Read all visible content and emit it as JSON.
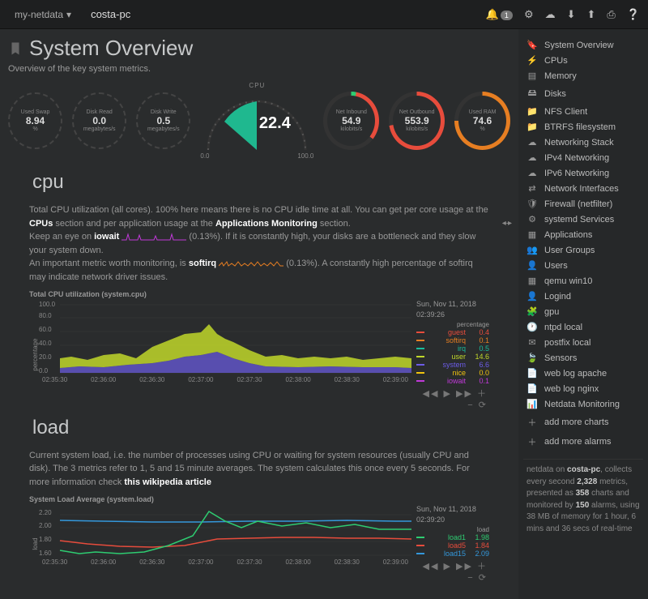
{
  "topbar": {
    "brand": "my-netdata",
    "hostname": "costa-pc",
    "alarm_count": "1"
  },
  "header": {
    "title": "System Overview",
    "subtitle": "Overview of the key system metrics."
  },
  "gauges": {
    "swap": {
      "label": "Used Swap",
      "value": "8.94",
      "unit": "%"
    },
    "diskRead": {
      "label": "Disk Read",
      "value": "0.0",
      "unit": "megabytes/s"
    },
    "diskWrite": {
      "label": "Disk Write",
      "value": "0.5",
      "unit": "megabytes/s"
    },
    "cpu": {
      "label": "CPU",
      "value": "22.4",
      "min": "0.0",
      "max": "100.0"
    },
    "netIn": {
      "label": "Net Inbound",
      "value": "54.9",
      "unit": "kilobits/s"
    },
    "netOut": {
      "label": "Net Outbound",
      "value": "553.9",
      "unit": "kilobits/s"
    },
    "ram": {
      "label": "Used RAM",
      "value": "74.6",
      "unit": "%"
    }
  },
  "cpu": {
    "heading": "cpu",
    "p1a": "Total CPU utilization (all cores). 100% here means there is no CPU idle time at all. You can get per core usage at the ",
    "p1b": "CPUs",
    "p1c": " section and per application usage at the ",
    "p1d": "Applications Monitoring",
    "p1e": " section.",
    "p2a": "Keep an eye on ",
    "p2b": "iowait",
    "p2c": " (",
    "p2d": "0.13%",
    "p2e": "). If it is constantly high, your disks are a bottleneck and they slow your system down.",
    "p3a": "An important metric worth monitoring, is ",
    "p3b": "softirq",
    "p3c": " (",
    "p3d": "0.13%",
    "p3e": "). A constantly high percentage of softirq may indicate network driver issues."
  },
  "cpu_chart": {
    "title": "Total CPU utilization (system.cpu)",
    "ylabel": "percentage",
    "ts1": "Sun, Nov 11, 2018",
    "ts2": "02:39:26",
    "lhead": "percentage",
    "legend": [
      {
        "name": "guest",
        "value": "0.4",
        "color": "#e74c3c"
      },
      {
        "name": "softirq",
        "value": "0.1",
        "color": "#e67e22"
      },
      {
        "name": "irq",
        "value": "0.5",
        "color": "#1abc9c"
      },
      {
        "name": "user",
        "value": "14.6",
        "color": "#c0d72a"
      },
      {
        "name": "system",
        "value": "6.6",
        "color": "#6c5ce7"
      },
      {
        "name": "nice",
        "value": "0.0",
        "color": "#f1c40f"
      },
      {
        "name": "iowait",
        "value": "0.1",
        "color": "#c039d8"
      }
    ],
    "xticks": [
      "02:35:30",
      "02:36:00",
      "02:36:30",
      "02:37:00",
      "02:37:30",
      "02:38:00",
      "02:38:30",
      "02:39:00"
    ],
    "yticks": [
      "0.0",
      "20.0",
      "40.0",
      "60.0",
      "80.0",
      "100.0"
    ],
    "controls": "◀◀ ▶ ▶▶ ＋ − ⟳"
  },
  "load": {
    "heading": "load",
    "p1": "Current system load, i.e. the number of processes using CPU or waiting for system resources (usually CPU and disk). The 3 metrics refer to 1, 5 and 15 minute averages. The system calculates this once every 5 seconds. For more information check ",
    "p1link": "this wikipedia article"
  },
  "load_chart": {
    "title": "System Load Average (system.load)",
    "ylabel": "load",
    "ts1": "Sun, Nov 11, 2018",
    "ts2": "02:39:20",
    "lhead": "load",
    "legend": [
      {
        "name": "load1",
        "value": "1.98",
        "color": "#2ecc71"
      },
      {
        "name": "load5",
        "value": "1.84",
        "color": "#e74c3c"
      },
      {
        "name": "load15",
        "value": "2.09",
        "color": "#3498db"
      }
    ],
    "yticks": [
      "1.60",
      "1.80",
      "2.00",
      "2.20"
    ],
    "xticks": [
      "02:35:30",
      "02:36:00",
      "02:36:30",
      "02:37:00",
      "02:37:30",
      "02:38:00",
      "02:38:30",
      "02:39:00"
    ],
    "controls": "◀◀ ▶ ▶▶ ＋ − ⟳"
  },
  "sidebar": {
    "items": [
      {
        "icon": "🔖",
        "label": "System Overview"
      },
      {
        "icon": "⚡",
        "label": "CPUs"
      },
      {
        "icon": "▤",
        "label": "Memory"
      },
      {
        "icon": "🖴",
        "label": "Disks"
      },
      {
        "icon": "📁",
        "label": "NFS Client"
      },
      {
        "icon": "📁",
        "label": "BTRFS filesystem"
      },
      {
        "icon": "☁",
        "label": "Networking Stack"
      },
      {
        "icon": "☁",
        "label": "IPv4 Networking"
      },
      {
        "icon": "☁",
        "label": "IPv6 Networking"
      },
      {
        "icon": "⇄",
        "label": "Network Interfaces"
      },
      {
        "icon": "🛡",
        "label": "Firewall (netfilter)"
      },
      {
        "icon": "⚙",
        "label": "systemd Services"
      },
      {
        "icon": "▦",
        "label": "Applications"
      },
      {
        "icon": "👥",
        "label": "User Groups"
      },
      {
        "icon": "👤",
        "label": "Users"
      },
      {
        "icon": "▦",
        "label": "qemu win10"
      },
      {
        "icon": "👤",
        "label": "Logind"
      },
      {
        "icon": "🧩",
        "label": "gpu"
      },
      {
        "icon": "🕐",
        "label": "ntpd local"
      },
      {
        "icon": "✉",
        "label": "postfix local"
      },
      {
        "icon": "🍃",
        "label": "Sensors"
      },
      {
        "icon": "📄",
        "label": "web log apache"
      },
      {
        "icon": "📄",
        "label": "web log nginx"
      },
      {
        "icon": "📊",
        "label": "Netdata Monitoring"
      }
    ],
    "add_charts": "add more charts",
    "add_alarms": "add more alarms",
    "info_host": "costa-pc",
    "info_metrics": "2,328",
    "info_charts": "358",
    "info_alarms": "150",
    "info_uptime": "1 hour, 6 mins and 36 secs"
  },
  "chart_data": [
    {
      "type": "area",
      "title": "Total CPU utilization (system.cpu)",
      "ylabel": "percentage",
      "ylim": [
        0,
        100
      ],
      "x": [
        "02:35:30",
        "02:36:00",
        "02:36:30",
        "02:37:00",
        "02:37:30",
        "02:38:00",
        "02:38:30",
        "02:39:00",
        "02:39:26"
      ],
      "series": [
        {
          "name": "guest",
          "color": "#e74c3c",
          "values": [
            0.4,
            0.3,
            0.4,
            0.5,
            0.4,
            0.4,
            0.3,
            0.4,
            0.4
          ]
        },
        {
          "name": "softirq",
          "color": "#e67e22",
          "values": [
            0.1,
            0.1,
            0.1,
            0.1,
            0.1,
            0.1,
            0.1,
            0.1,
            0.1
          ]
        },
        {
          "name": "irq",
          "color": "#1abc9c",
          "values": [
            0.5,
            0.5,
            0.5,
            0.5,
            0.5,
            0.5,
            0.5,
            0.5,
            0.5
          ]
        },
        {
          "name": "user",
          "color": "#c0d72a",
          "values": [
            14,
            15,
            22,
            35,
            30,
            16,
            15,
            15,
            14.6
          ]
        },
        {
          "name": "system",
          "color": "#6c5ce7",
          "values": [
            6,
            6,
            8,
            10,
            9,
            6,
            6,
            6,
            6.6
          ]
        },
        {
          "name": "nice",
          "color": "#f1c40f",
          "values": [
            0,
            0,
            0,
            0,
            0,
            0,
            0,
            0,
            0
          ]
        },
        {
          "name": "iowait",
          "color": "#c039d8",
          "values": [
            0.1,
            0.1,
            0.1,
            0.1,
            0.1,
            0.1,
            0.1,
            0.1,
            0.1
          ]
        }
      ]
    },
    {
      "type": "line",
      "title": "System Load Average (system.load)",
      "ylabel": "load",
      "ylim": [
        1.6,
        2.3
      ],
      "x": [
        "02:35:30",
        "02:36:00",
        "02:36:30",
        "02:37:00",
        "02:37:30",
        "02:38:00",
        "02:38:30",
        "02:39:00",
        "02:39:20"
      ],
      "series": [
        {
          "name": "load1",
          "color": "#2ecc71",
          "values": [
            1.65,
            1.6,
            1.62,
            1.9,
            2.28,
            2.0,
            2.08,
            2.05,
            1.98
          ]
        },
        {
          "name": "load5",
          "color": "#e74c3c",
          "values": [
            1.8,
            1.75,
            1.72,
            1.75,
            1.85,
            1.85,
            1.86,
            1.85,
            1.84
          ]
        },
        {
          "name": "load15",
          "color": "#3498db",
          "values": [
            2.1,
            2.09,
            2.08,
            2.08,
            2.09,
            2.09,
            2.1,
            2.09,
            2.09
          ]
        }
      ]
    }
  ]
}
